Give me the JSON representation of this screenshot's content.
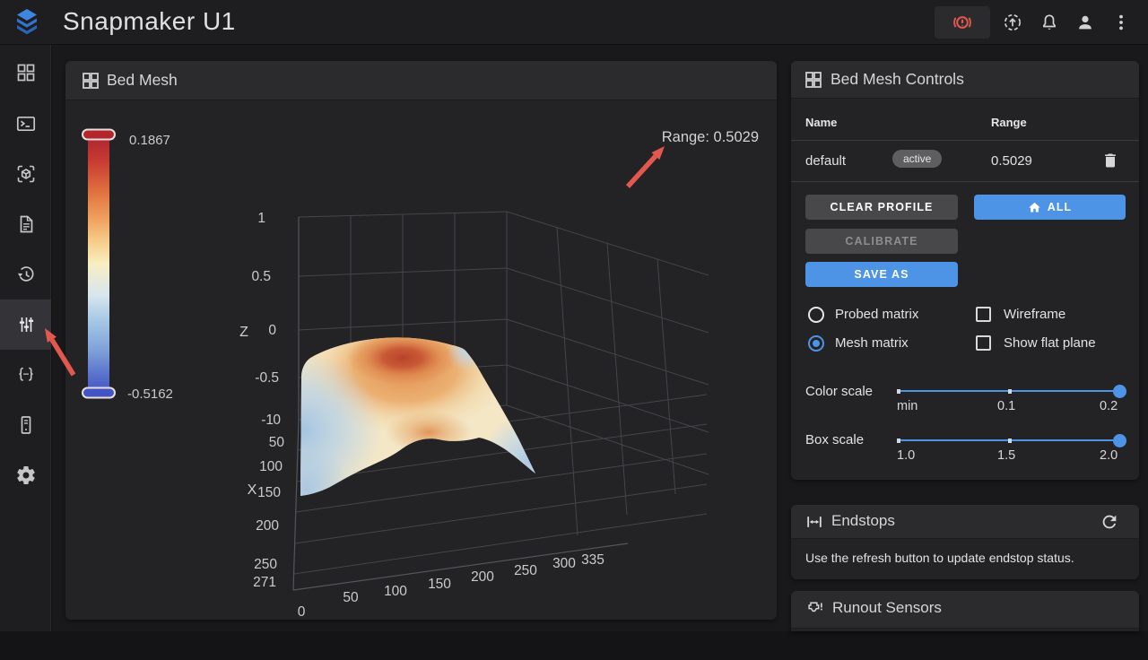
{
  "topbar": {
    "title": "Snapmaker U1",
    "icons": [
      "emergency-stop",
      "update",
      "notifications",
      "account",
      "overflow-menu"
    ]
  },
  "sidebar": {
    "icons": [
      "dashboard",
      "console",
      "preview",
      "jobs",
      "history",
      "tune",
      "configure",
      "system",
      "settings"
    ],
    "active": "tune"
  },
  "bed_mesh": {
    "title": "Bed Mesh",
    "range_annotation": "Range: 0.5029",
    "colorbar": {
      "max": "0.1867",
      "min": "-0.5162"
    },
    "axes": {
      "z_label": "Z",
      "x_label": "X",
      "z_ticks": [
        "1",
        "0.5",
        "0",
        "-0.5",
        "-1"
      ],
      "x_ticks": [
        "0",
        "50",
        "100",
        "150",
        "200",
        "250",
        "271"
      ],
      "y_ticks": [
        "0",
        "50",
        "100",
        "150",
        "200",
        "250",
        "300",
        "335"
      ]
    }
  },
  "chart_data": {
    "type": "surface",
    "title": "Bed Mesh",
    "z_max": 0.1867,
    "z_min": -0.5162,
    "range": 0.5029,
    "x_axis": {
      "label": "X",
      "range": [
        0,
        271
      ],
      "ticks": [
        0,
        50,
        100,
        150,
        200,
        250,
        271
      ]
    },
    "y_axis": {
      "range": [
        0,
        335
      ],
      "ticks": [
        0,
        50,
        100,
        150,
        200,
        250,
        300,
        335
      ]
    },
    "z_axis": {
      "label": "Z",
      "range": [
        -1,
        1
      ],
      "ticks": [
        1,
        0.5,
        0,
        -0.5,
        -1
      ]
    },
    "colorscale": "red-yellow-blue reversed (red = high, blue = low)",
    "shape": "dome-shaped mesh: high red-orange region in center (~0.18), cream mid-levels, pale blue low edges (~-0.51) at left and right extremes"
  },
  "controls": {
    "title": "Bed Mesh Controls",
    "table": {
      "name_header": "Name",
      "range_header": "Range",
      "rows": [
        {
          "name": "default",
          "badge": "active",
          "range": "0.5029"
        }
      ]
    },
    "buttons": {
      "clear_profile": "CLEAR PROFILE",
      "all": "ALL",
      "calibrate": "CALIBRATE",
      "save_as": "SAVE AS"
    },
    "radios": [
      {
        "label": "Probed matrix",
        "selected": false
      },
      {
        "label": "Mesh matrix",
        "selected": true
      }
    ],
    "checkboxes": [
      {
        "label": "Wireframe",
        "checked": false
      },
      {
        "label": "Show flat plane",
        "checked": false
      }
    ],
    "sliders": [
      {
        "label": "Color scale",
        "tick_labels": [
          "min",
          "0.1",
          "0.2"
        ],
        "thumb_at": "max"
      },
      {
        "label": "Box scale",
        "tick_labels": [
          "1.0",
          "1.5",
          "2.0"
        ],
        "thumb_at": "max"
      }
    ]
  },
  "endstops": {
    "title": "Endstops",
    "message": "Use the refresh button to update endstop status."
  },
  "runout": {
    "title": "Runout Sensors"
  },
  "colors": {
    "accent": "#4d93e6",
    "alert_red": "#e2584f",
    "colorbar_top": "#b0252c",
    "colorbar_bottom": "#4355c5"
  }
}
